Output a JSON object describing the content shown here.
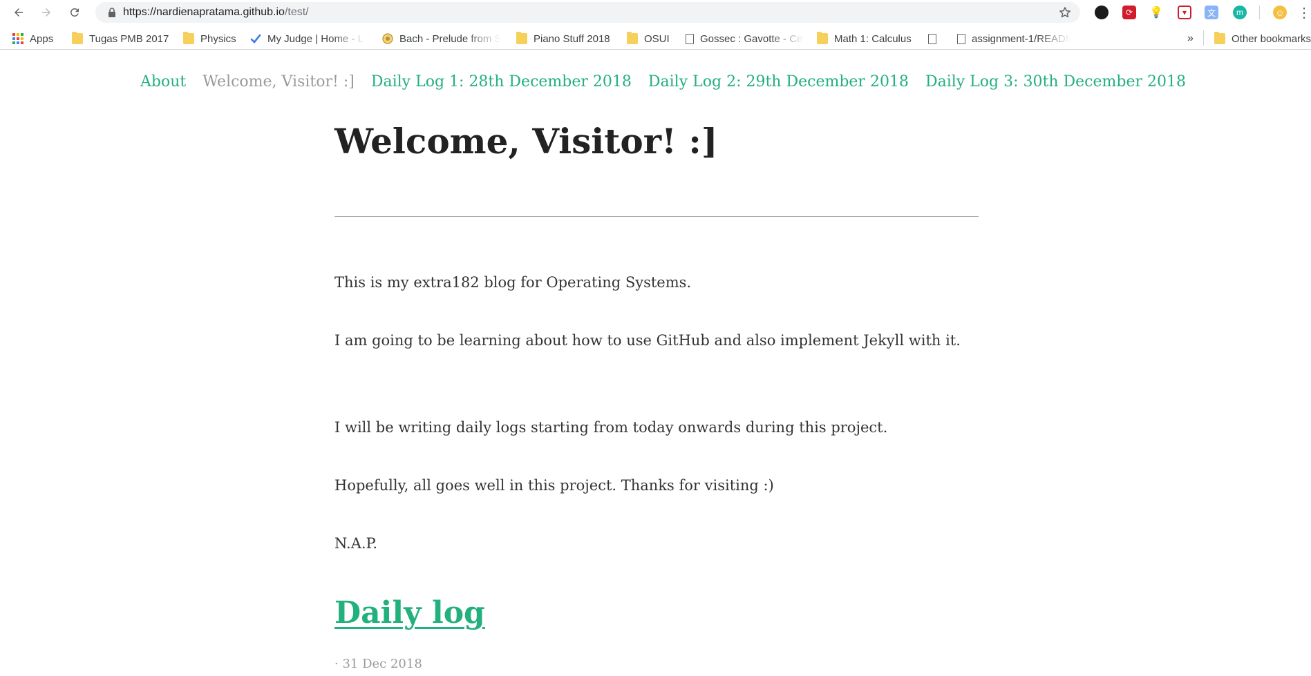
{
  "browser": {
    "url_host": "https://nardienapratama.github.io",
    "url_path": "/test/",
    "bookmarks": [
      {
        "label": "Apps",
        "icon": "apps-grid-icon"
      },
      {
        "label": "Tugas PMB 2017",
        "icon": "folder-icon"
      },
      {
        "label": "Physics",
        "icon": "folder-icon"
      },
      {
        "label": "My Judge | Home - L",
        "icon": "checkmark-icon"
      },
      {
        "label": "Bach - Prelude from S",
        "icon": "site-favicon-icon"
      },
      {
        "label": "Piano Stuff 2018",
        "icon": "folder-icon"
      },
      {
        "label": "OSUI",
        "icon": "folder-icon"
      },
      {
        "label": "Gossec : Gavotte - Ce",
        "icon": "document-icon"
      },
      {
        "label": "Math 1: Calculus",
        "icon": "folder-icon"
      },
      {
        "label": "",
        "icon": "document-icon"
      },
      {
        "label": "assignment-1/READM",
        "icon": "document-icon"
      },
      {
        "label": "Other bookmarks",
        "icon": "folder-icon"
      }
    ],
    "overflow_label": "»"
  },
  "site": {
    "nav": [
      {
        "label": "About",
        "active": false
      },
      {
        "label": "Welcome, Visitor! :]",
        "active": true
      },
      {
        "label": "Daily Log 1: 28th December 2018",
        "active": false
      },
      {
        "label": "Daily Log 2: 29th December 2018",
        "active": false
      },
      {
        "label": "Daily Log 3: 30th December 2018",
        "active": false
      }
    ],
    "accent_color": "#22b07d",
    "muted_color": "#9a9a9a"
  },
  "page": {
    "title": "Welcome, Visitor! :]",
    "paragraphs": [
      "This is my extra182 blog for Operating Systems.",
      "I am going to be learning about how to use GitHub and also implement Jekyll with it.",
      "I will be writing daily logs starting from today onwards during this project.",
      "Hopefully, all goes well in this project. Thanks for visiting :)",
      "N.A.P."
    ],
    "post": {
      "title": "Daily log",
      "meta": "· 31 Dec 2018"
    }
  }
}
